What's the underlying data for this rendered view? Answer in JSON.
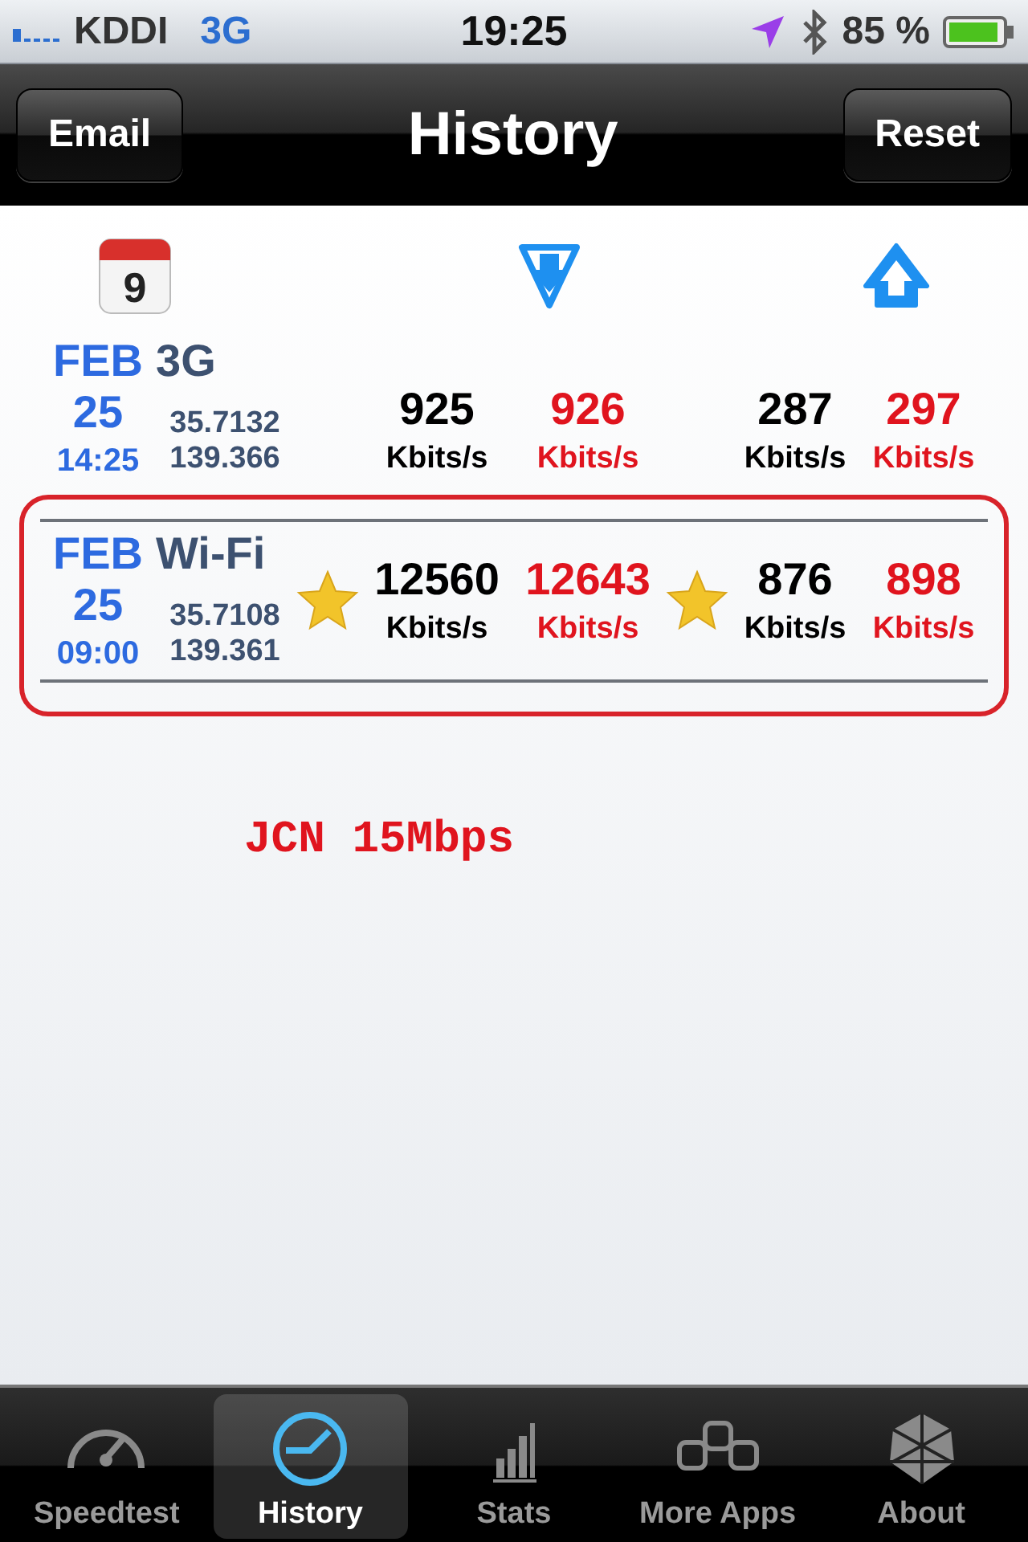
{
  "status_bar": {
    "carrier": "KDDI",
    "network": "3G",
    "time": "19:25",
    "battery": "85 %"
  },
  "nav_bar": {
    "left_button": "Email",
    "title": "History",
    "right_button": "Reset"
  },
  "header": {
    "calendar_day": "9"
  },
  "tests": [
    {
      "month": "FEB",
      "day": "25",
      "time": "14:25",
      "network": "3G",
      "latitude": "35.7132",
      "longitude": "139.366",
      "highlighted": false,
      "download": {
        "starred": false,
        "values": [
          {
            "value": "925",
            "unit": "Kbits/s",
            "color": "#000000"
          },
          {
            "value": "926",
            "unit": "Kbits/s",
            "color": "#e0141e"
          }
        ]
      },
      "upload": {
        "starred": false,
        "values": [
          {
            "value": "287",
            "unit": "Kbits/s",
            "color": "#000000"
          },
          {
            "value": "297",
            "unit": "Kbits/s",
            "color": "#e0141e"
          }
        ]
      }
    },
    {
      "month": "FEB",
      "day": "25",
      "time": "09:00",
      "network": "Wi-Fi",
      "latitude": "35.7108",
      "longitude": "139.361",
      "highlighted": true,
      "download": {
        "starred": true,
        "values": [
          {
            "value": "12560",
            "unit": "Kbits/s",
            "color": "#000000"
          },
          {
            "value": "12643",
            "unit": "Kbits/s",
            "color": "#e0141e"
          }
        ]
      },
      "upload": {
        "starred": true,
        "values": [
          {
            "value": "876",
            "unit": "Kbits/s",
            "color": "#000000"
          },
          {
            "value": "898",
            "unit": "Kbits/s",
            "color": "#e0141e"
          }
        ]
      }
    }
  ],
  "annotation": "JCN 15Mbps",
  "tab_bar": [
    {
      "label": "Speedtest",
      "kind": "speedometer",
      "selected": false
    },
    {
      "label": "History",
      "kind": "clock",
      "selected": true
    },
    {
      "label": "Stats",
      "kind": "bars",
      "selected": false
    },
    {
      "label": "More Apps",
      "kind": "apps",
      "selected": false
    },
    {
      "label": "About",
      "kind": "about",
      "selected": false
    }
  ]
}
